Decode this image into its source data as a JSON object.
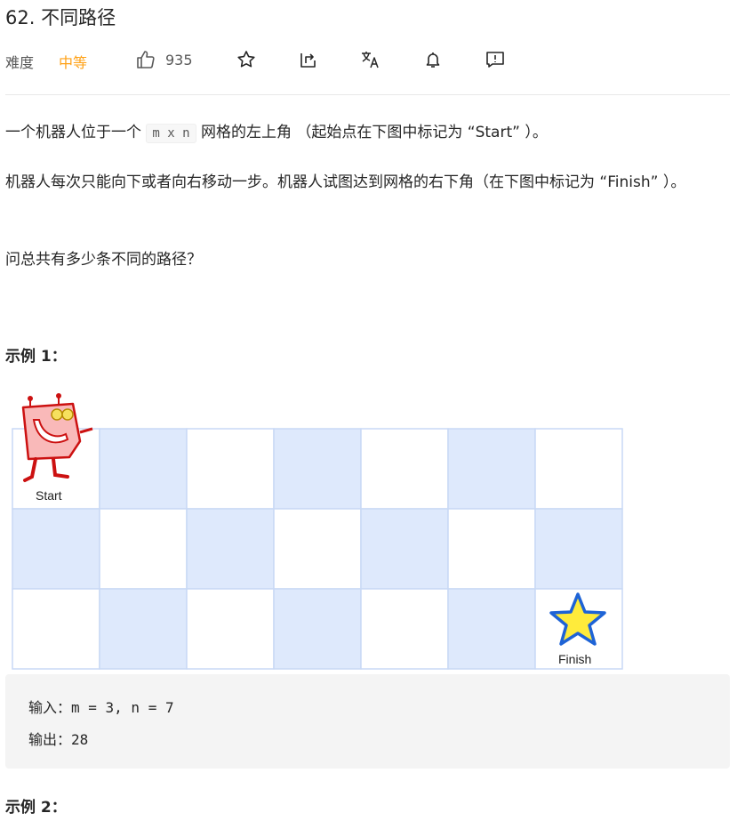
{
  "problem": {
    "title": "62. 不同路径",
    "difficulty_label": "难度",
    "difficulty_value": "中等",
    "likes": "935",
    "colors": {
      "difficulty": "#ffa116",
      "grid_blue": "#dee9fc"
    }
  },
  "toolbar": {
    "icons": [
      "thumbs-up-icon",
      "star-icon",
      "share-icon",
      "translate-icon",
      "bell-icon",
      "feedback-icon"
    ]
  },
  "description": {
    "p1_before": "一个机器人位于一个 ",
    "p1_code": "m x n",
    "p1_after": " 网格的左上角 （起始点在下图中标记为 “Start” ）。",
    "p2": "机器人每次只能向下或者向右移动一步。机器人试图达到网格的右下角（在下图中标记为 “Finish” ）。",
    "p3": "问总共有多少条不同的路径？"
  },
  "example1": {
    "title": "示例 1：",
    "figure": {
      "rows": 3,
      "cols": 7,
      "start_label": "Start",
      "finish_label": "Finish"
    },
    "input_line": "输入：m = 3, n = 7",
    "output_line": "输出：28"
  },
  "example2": {
    "title": "示例 2："
  }
}
